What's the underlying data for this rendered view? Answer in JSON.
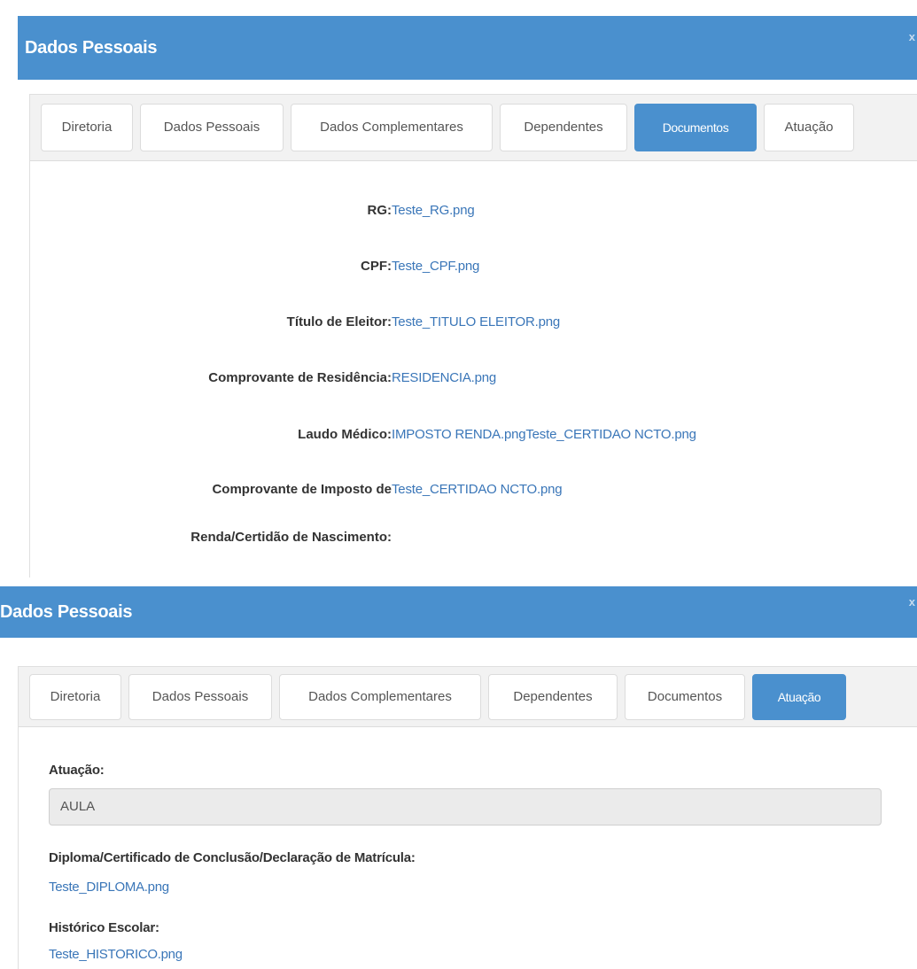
{
  "panel1": {
    "title": "Dados Pessoais",
    "close": "x",
    "tabs": [
      {
        "label": "Diretoria"
      },
      {
        "label": "Dados Pessoais"
      },
      {
        "label": "Dados Complementares"
      },
      {
        "label": "Dependentes"
      },
      {
        "label": "Documentos",
        "active": true
      },
      {
        "label": "Atuação"
      }
    ],
    "documents": [
      {
        "label": "RG:",
        "file": "Teste_RG.png"
      },
      {
        "label": "CPF:",
        "file": "Teste_CPF.png"
      },
      {
        "label": "Título de Eleitor:",
        "file": "Teste_TITULO ELEITOR.png"
      },
      {
        "label": "Comprovante de Residência:",
        "file": "RESIDENCIA.png"
      },
      {
        "label": "Laudo Médico:",
        "file": "IMPOSTO RENDA.pngTeste_CERTIDAO NCTO.png"
      },
      {
        "label_line1": "Comprovante de Imposto de",
        "label_line2": "Renda/Certidão de Nascimento:",
        "file": "Teste_CERTIDAO NCTO.png"
      }
    ]
  },
  "panel2": {
    "title": "Dados Pessoais",
    "close": "x",
    "tabs": [
      {
        "label": "Diretoria"
      },
      {
        "label": "Dados Pessoais"
      },
      {
        "label": "Dados Complementares"
      },
      {
        "label": "Dependentes"
      },
      {
        "label": "Documentos"
      },
      {
        "label": "Atuação",
        "active": true
      }
    ],
    "atuacao_label": "Atuação:",
    "atuacao_value": "AULA",
    "diploma_label": "Diploma/Certificado de Conclusão/Declaração de Matrícula:",
    "diploma_file": "Teste_DIPLOMA.png",
    "historico_label": "Histórico Escolar:",
    "historico_file": "Teste_HISTORICO.png"
  },
  "colors": {
    "header_blue": "#4a90ce",
    "link_blue": "#3a76b8",
    "tab_bar_bg": "#f2f2f2"
  }
}
